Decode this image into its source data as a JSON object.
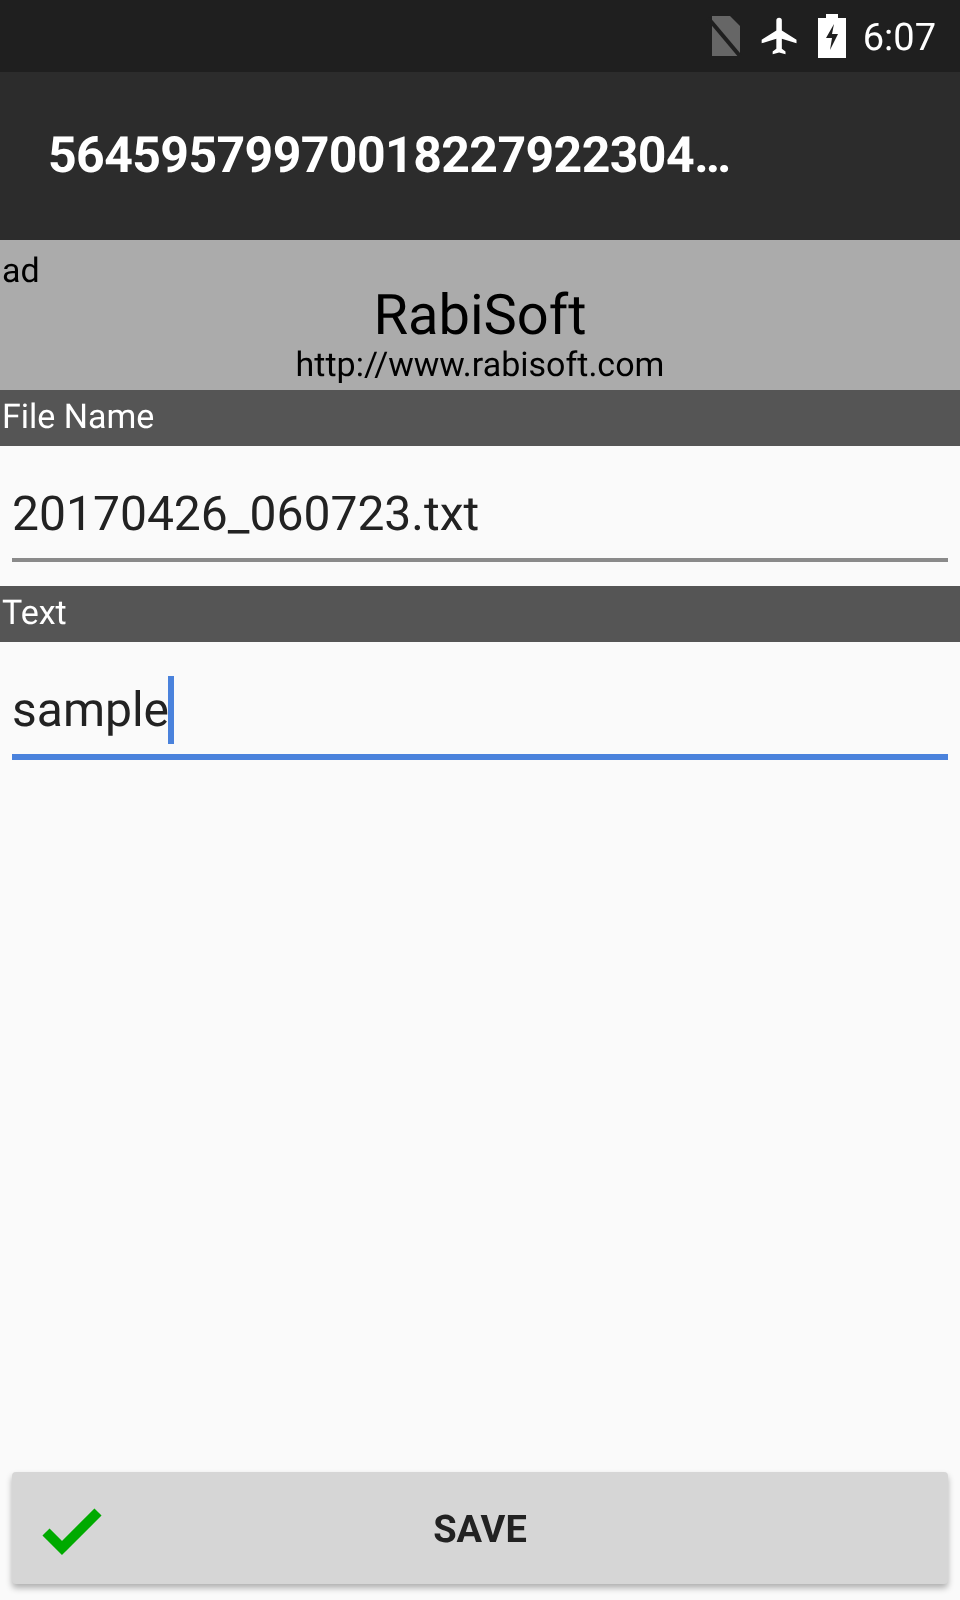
{
  "status_bar": {
    "time": "6:07"
  },
  "app_bar": {
    "title": "56459579970018227922304…"
  },
  "ad": {
    "label": "ad",
    "brand": "RabiSoft",
    "url": "http://www.rabisoft.com"
  },
  "fields": [
    {
      "label": "File Name",
      "value": "20170426_060723.txt",
      "focused": false
    },
    {
      "label": "Text",
      "value": "sample",
      "focused": true
    }
  ],
  "save_button": {
    "label": "SAVE"
  }
}
